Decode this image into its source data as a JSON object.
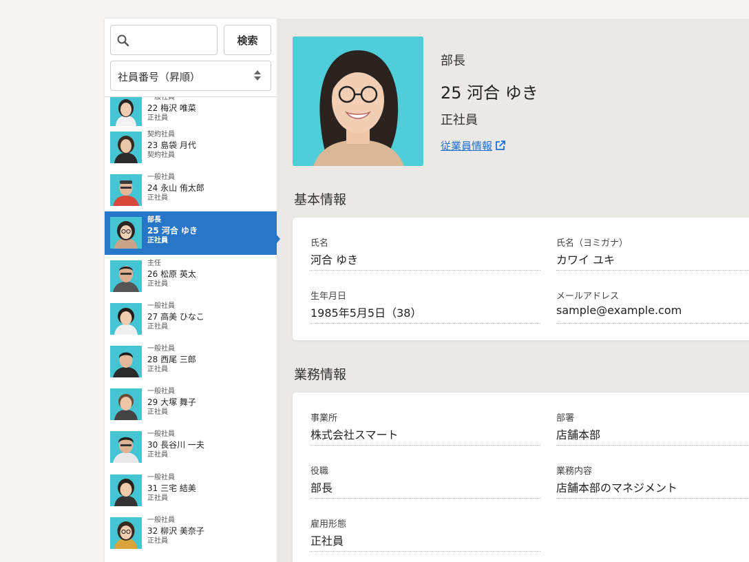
{
  "search": {
    "placeholder": "",
    "button_label": "検索"
  },
  "sort": {
    "selected": "社員番号（昇順）"
  },
  "employees": [
    {
      "position": "一般社員",
      "name": "22  梅沢 唯菜",
      "type": "正社員"
    },
    {
      "position": "契約社員",
      "name": "23  島袋 月代",
      "type": "契約社員"
    },
    {
      "position": "一般社員",
      "name": "24  永山 侑太郎",
      "type": "正社員"
    },
    {
      "position": "部長",
      "name": "25  河合 ゆき",
      "type": "正社員"
    },
    {
      "position": "主任",
      "name": "26  松原 英太",
      "type": "正社員"
    },
    {
      "position": "一般社員",
      "name": "27  高美 ひなこ",
      "type": "正社員"
    },
    {
      "position": "一般社員",
      "name": "28  西尾 三郎",
      "type": "正社員"
    },
    {
      "position": "一般社員",
      "name": "29  大塚 舞子",
      "type": "正社員"
    },
    {
      "position": "一般社員",
      "name": "30  長谷川 一夫",
      "type": "正社員"
    },
    {
      "position": "一般社員",
      "name": "31  三宅 結美",
      "type": "正社員"
    },
    {
      "position": "一般社員",
      "name": "32  柳沢 美奈子",
      "type": "正社員"
    }
  ],
  "profile": {
    "position": "部長",
    "name": "25 河合 ゆき",
    "type": "正社員",
    "link_label": "従業員情報"
  },
  "basic": {
    "title": "基本情報",
    "fields": [
      {
        "label": "氏名",
        "value": "河合 ゆき"
      },
      {
        "label": "氏名（ヨミガナ）",
        "value": "カワイ ユキ"
      },
      {
        "label": "生年月日",
        "value": "1985年5月5日（38）"
      },
      {
        "label": "メールアドレス",
        "value": "sample@example.com"
      }
    ]
  },
  "business": {
    "title": "業務情報",
    "fields": [
      {
        "label": "事業所",
        "value": "株式会社スマート"
      },
      {
        "label": "部署",
        "value": "店舗本部"
      },
      {
        "label": "役職",
        "value": "部長"
      },
      {
        "label": "業務内容",
        "value": "店舗本部のマネジメント"
      },
      {
        "label": "雇用形態",
        "value": "正社員"
      }
    ]
  },
  "colors": {
    "selected": "#2876c8",
    "avatar_bg": "#45c4d2",
    "link": "#1f6fcf"
  }
}
